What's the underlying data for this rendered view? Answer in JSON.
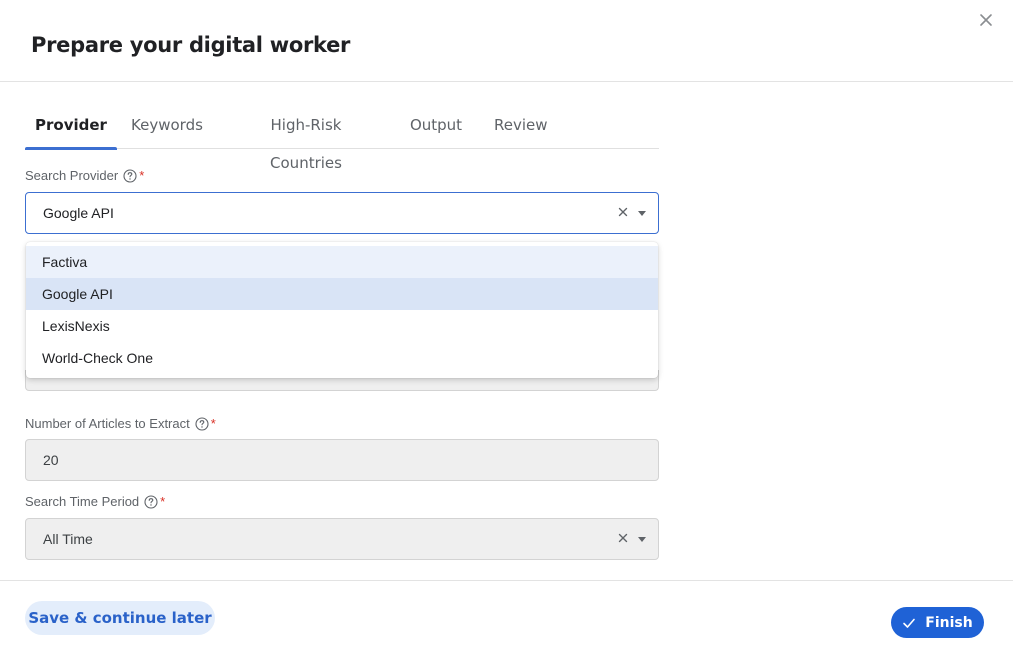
{
  "header": {
    "title": "Prepare your digital worker",
    "close_icon": "close-icon"
  },
  "tabs": [
    {
      "label": "Provider",
      "active": true
    },
    {
      "label": "Keywords",
      "active": false
    },
    {
      "label": "High-Risk Countries",
      "active": false
    },
    {
      "label": "Output",
      "active": false
    },
    {
      "label": "Review",
      "active": false
    }
  ],
  "form": {
    "search_provider": {
      "label": "Search Provider",
      "required_mark": "*",
      "value": "Google API",
      "options": [
        "Factiva",
        "Google API",
        "LexisNexis",
        "World-Check One"
      ],
      "selected": "Google API",
      "hovered": "Factiva"
    },
    "articles": {
      "label": "Number of Articles to Extract",
      "required_mark": "*",
      "value": "20"
    },
    "time_period": {
      "label": "Search Time Period",
      "required_mark": "*",
      "value": "All Time"
    }
  },
  "footer": {
    "save_label": "Save & continue later",
    "finish_label": "Finish"
  },
  "colors": {
    "accent": "#1f62d6",
    "tab_indicator": "#3c6fd1",
    "required": "#d93025",
    "save_bg": "#e3edfb"
  }
}
